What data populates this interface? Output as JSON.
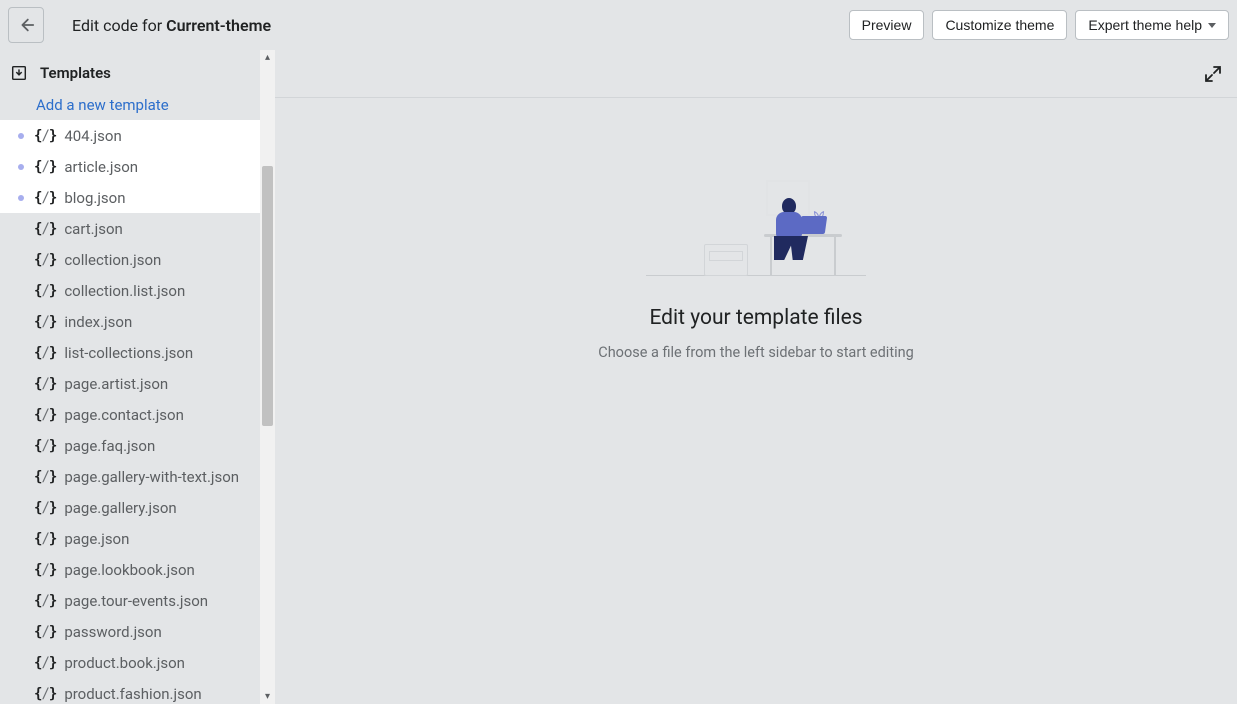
{
  "header": {
    "title_prefix": "Edit code for ",
    "theme_name": "Current-theme",
    "buttons": {
      "preview": "Preview",
      "customize": "Customize theme",
      "expert_help": "Expert theme help"
    }
  },
  "sidebar": {
    "section_label": "Templates",
    "add_link": "Add a new template",
    "files": [
      {
        "name": "404.json",
        "selected": true
      },
      {
        "name": "article.json",
        "selected": true
      },
      {
        "name": "blog.json",
        "selected": true
      },
      {
        "name": "cart.json",
        "selected": false
      },
      {
        "name": "collection.json",
        "selected": false
      },
      {
        "name": "collection.list.json",
        "selected": false
      },
      {
        "name": "index.json",
        "selected": false
      },
      {
        "name": "list-collections.json",
        "selected": false
      },
      {
        "name": "page.artist.json",
        "selected": false
      },
      {
        "name": "page.contact.json",
        "selected": false
      },
      {
        "name": "page.faq.json",
        "selected": false
      },
      {
        "name": "page.gallery-with-text.json",
        "selected": false
      },
      {
        "name": "page.gallery.json",
        "selected": false
      },
      {
        "name": "page.json",
        "selected": false
      },
      {
        "name": "page.lookbook.json",
        "selected": false
      },
      {
        "name": "page.tour-events.json",
        "selected": false
      },
      {
        "name": "password.json",
        "selected": false
      },
      {
        "name": "product.book.json",
        "selected": false
      },
      {
        "name": "product.fashion.json",
        "selected": false
      }
    ]
  },
  "empty_state": {
    "title": "Edit your template files",
    "subtitle": "Choose a file from the left sidebar to start editing"
  }
}
